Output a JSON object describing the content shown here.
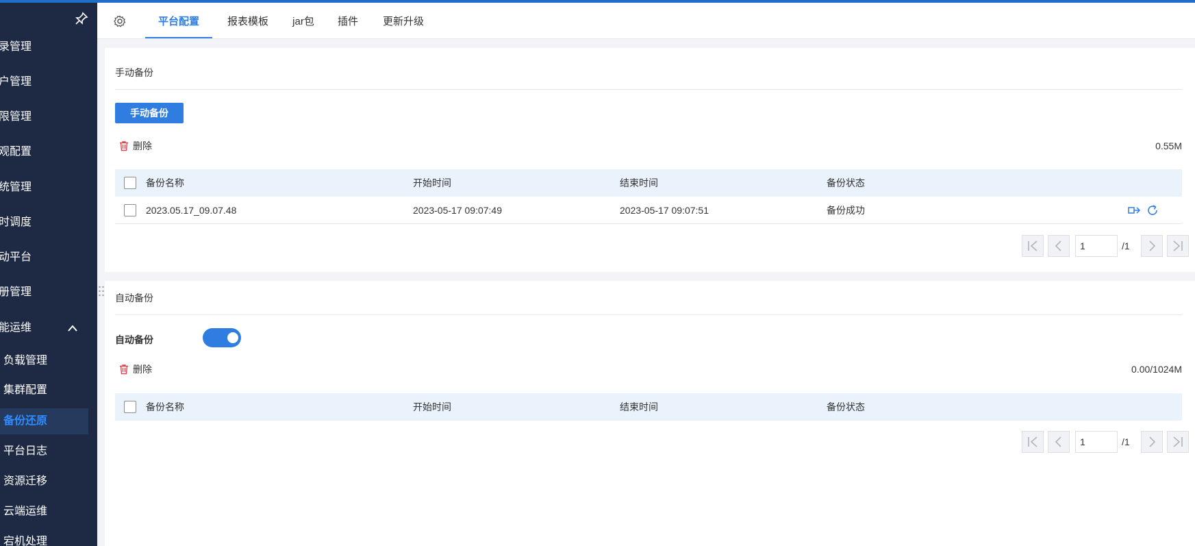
{
  "sidebar": {
    "items": [
      {
        "label": "录管理"
      },
      {
        "label": "户管理"
      },
      {
        "label": "限管理"
      },
      {
        "label": "观配置"
      },
      {
        "label": "统管理"
      },
      {
        "label": "时调度"
      },
      {
        "label": "动平台"
      },
      {
        "label": "册管理"
      },
      {
        "label": "能运维"
      }
    ],
    "sub_items": [
      {
        "label": "负载管理"
      },
      {
        "label": "集群配置"
      },
      {
        "label": "备份还原"
      },
      {
        "label": "平台日志"
      },
      {
        "label": "资源迁移"
      },
      {
        "label": "云端运维"
      },
      {
        "label": "宕机处理"
      }
    ]
  },
  "tabs": [
    {
      "label": "平台配置"
    },
    {
      "label": "报表模板"
    },
    {
      "label": "jar包"
    },
    {
      "label": "插件"
    },
    {
      "label": "更新升级"
    }
  ],
  "manual": {
    "title": "手动备份",
    "button_label": "手动备份",
    "delete_label": "删除",
    "size": "0.55M",
    "columns": [
      "备份名称",
      "开始时间",
      "结束时间",
      "备份状态"
    ],
    "rows": [
      {
        "name": "2023.05.17_09.07.48",
        "start": "2023-05-17 09:07:49",
        "end": "2023-05-17 09:07:51",
        "status": "备份成功"
      }
    ],
    "pager": {
      "page": "1",
      "total": "/1"
    }
  },
  "auto": {
    "title": "自动备份",
    "toggle_label": "自动备份",
    "toggle_on": true,
    "delete_label": "删除",
    "size": "0.00/1024M",
    "columns": [
      "备份名称",
      "开始时间",
      "结束时间",
      "备份状态"
    ],
    "pager": {
      "page": "1",
      "total": "/1"
    }
  },
  "colors": {
    "accent": "#2f7de1",
    "sidebar": "#1e2a44",
    "danger": "#e0434b"
  }
}
